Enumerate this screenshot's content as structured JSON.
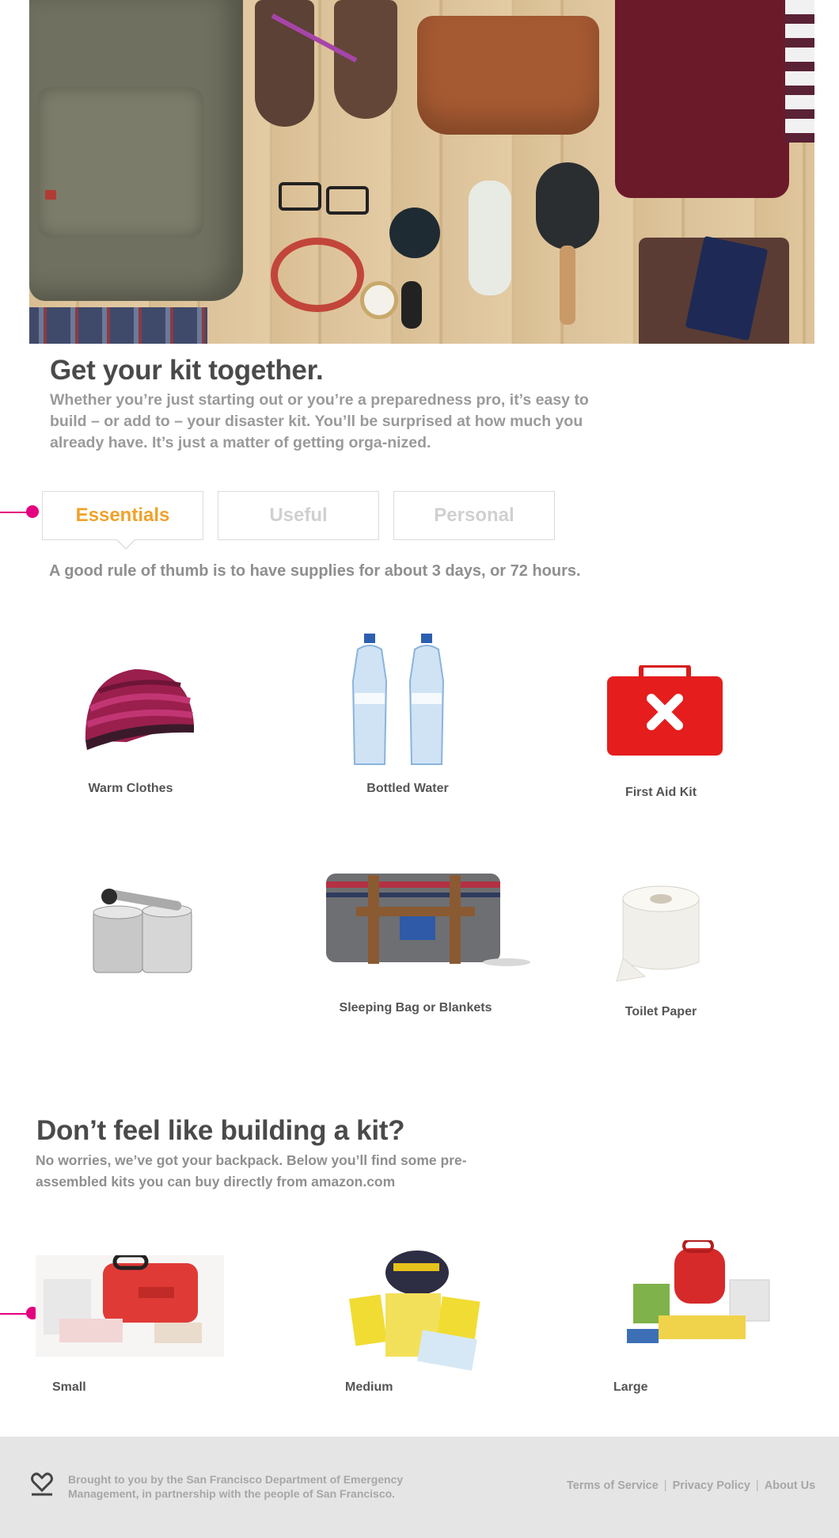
{
  "kit": {
    "title": "Get your kit together.",
    "intro": "Whether you’re just starting out or you’re a preparedness pro, it’s easy to build – or add to – your disaster kit. You’ll be surprised at how much you already have. It’s just a matter of getting orga-nized.",
    "tabs": [
      {
        "label": "Essentials",
        "active": true
      },
      {
        "label": "Useful",
        "active": false
      },
      {
        "label": "Personal",
        "active": false
      }
    ],
    "rule": "A good rule of thumb is to have supplies for about 3 days, or 72 hours.",
    "items": [
      {
        "label": "Warm Clothes",
        "icon": "knit-hat-icon"
      },
      {
        "label": "Bottled Water",
        "icon": "water-bottles-icon"
      },
      {
        "label": "First Aid Kit",
        "icon": "first-aid-kit-icon"
      },
      {
        "label": "",
        "icon": "cans-and-opener-icon"
      },
      {
        "label": "Sleeping Bag or Blankets",
        "icon": "rolled-blanket-icon"
      },
      {
        "label": "Toilet Paper",
        "icon": "toilet-paper-icon"
      }
    ]
  },
  "prebuilt": {
    "title": "Don’t feel like building a kit?",
    "intro": "No worries, we’ve got your backpack. Below you’ll find some pre-assembled kits you can buy directly from amazon.com",
    "kits": [
      {
        "label": "Small"
      },
      {
        "label": "Medium"
      },
      {
        "label": "Large"
      }
    ]
  },
  "footer": {
    "credit": "Brought to you by the San Francisco Department of Emergency Management, in partnership with the people of San Francisco.",
    "links": [
      "Terms of Service",
      "Privacy Policy",
      "About Us"
    ],
    "separator": "|"
  },
  "colors": {
    "accent_pink": "#e4007f",
    "active_tab": "#f0a22a",
    "inactive_tab": "#d0d0d0",
    "footer_bg": "#e5e5e5"
  }
}
